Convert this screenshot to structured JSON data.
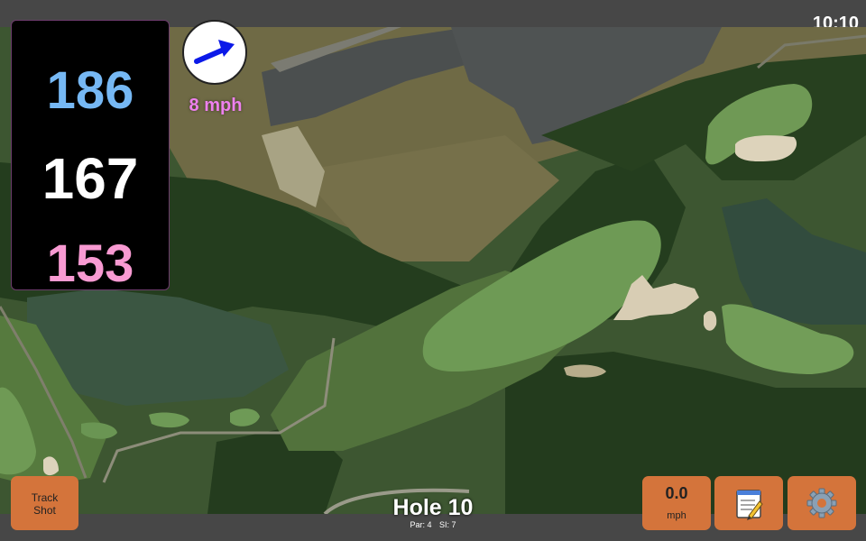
{
  "status_bar": {
    "time": "10:10"
  },
  "distances": {
    "back": "186",
    "middle": "167",
    "front": "153"
  },
  "wind": {
    "speed": "8 mph",
    "direction_icon": "arrow-right-up-icon"
  },
  "buttons": {
    "track_shot_line1": "Track",
    "track_shot_line2": "Shot",
    "speed_value": "0.0",
    "speed_unit": "mph",
    "notes_icon": "notepad-icon",
    "settings_icon": "gear-icon"
  },
  "hole": {
    "title": "Hole 10",
    "par": "Par: 4",
    "si": "SI: 7"
  },
  "colors": {
    "back_distance": "#76b8f4",
    "middle_distance": "#ffffff",
    "front_distance": "#f89ad2",
    "wind_text": "#ee80ee",
    "button_bg": "#d4743b"
  }
}
